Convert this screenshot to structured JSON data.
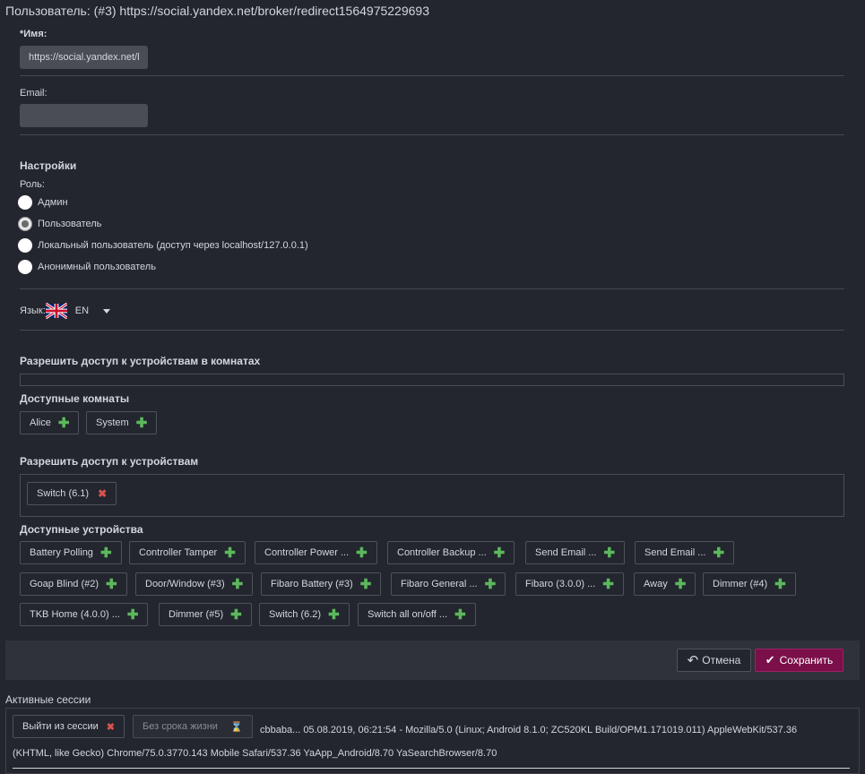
{
  "header": {
    "title": "Пользователь: (#3) https://social.yandex.net/broker/redirect1564975229693"
  },
  "name": {
    "label": "*Имя:",
    "value": "https://social.yandex.net/b"
  },
  "email": {
    "label": "Email:",
    "value": ""
  },
  "settings": {
    "title": "Настройки",
    "role_label": "Роль:",
    "roles": [
      {
        "label": "Админ",
        "checked": false
      },
      {
        "label": "Пользователь",
        "checked": true
      },
      {
        "label": "Локальный пользователь (доступ через localhost/127.0.0.1)",
        "checked": false
      },
      {
        "label": "Анонимный пользователь",
        "checked": false
      }
    ]
  },
  "language": {
    "label": "Язык:",
    "value": "EN",
    "flag": "uk-flag-icon"
  },
  "rooms": {
    "allow_title": "Разрешить доступ к устройствам в комнатах",
    "available_title": "Доступные комнаты",
    "available": [
      "Alice",
      "System"
    ]
  },
  "devices": {
    "allow_title": "Разрешить доступ к устройствам",
    "allowed": [
      "Switch (6.1)"
    ],
    "available_title": "Доступные устройства",
    "available": [
      "Battery Polling",
      "Controller Tamper",
      "Controller Power ...",
      "Controller Backup ...",
      "Send Email ...",
      "Send Email ...",
      "Goap Blind (#2)",
      "Door/Window (#3)",
      "Fibaro Battery (#3)",
      "Fibaro General ...",
      "Fibaro (3.0.0) ...",
      "Away",
      "Dimmer (#4)",
      "TKB Home (4.0.0) ...",
      "Dimmer (#5)",
      "Switch (6.2)",
      "Switch all on/off ..."
    ]
  },
  "actions": {
    "cancel": "Отмена",
    "save": "Сохранить"
  },
  "sessions": {
    "title": "Активные сессии",
    "logout_label": "Выйти из сессии",
    "nolimit_label": "Без срока жизни",
    "line1": "cbbaba...   05.08.2019, 06:21:54   -   Mozilla/5.0 (Linux; Android 8.1.0; ZC520KL Build/OPM1.171019.011) AppleWebKit/537.36",
    "line2": "(KHTML, like Gecko) Chrome/75.0.3770.143 Mobile Safari/537.36 YaApp_Android/8.70 YaSearchBrowser/8.70"
  },
  "colors": {
    "background": "#23262e",
    "save": "#7a0f4a",
    "plus": "#5cb85c",
    "remove": "#d9534f"
  }
}
